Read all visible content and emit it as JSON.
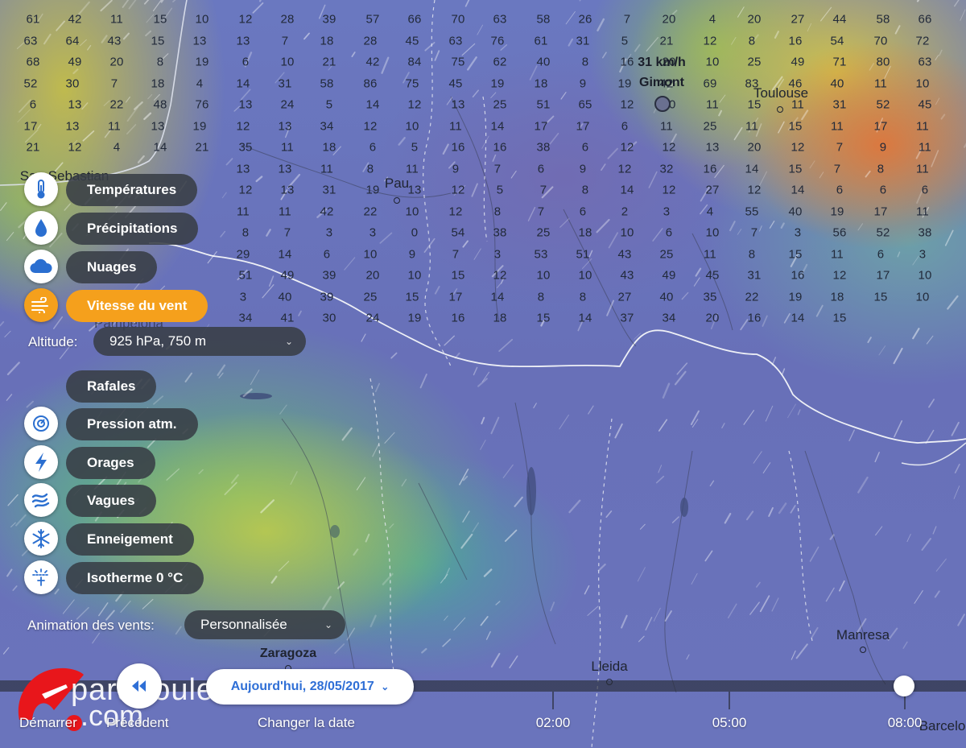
{
  "map": {
    "cities": [
      {
        "name": "Pau"
      },
      {
        "name": "Toulouse"
      },
      {
        "name": "Zaragoza"
      },
      {
        "name": "Lleida"
      },
      {
        "name": "Manresa"
      },
      {
        "name": "Pampelona"
      },
      {
        "name": "San Sebastian"
      },
      {
        "name": "Barcelona"
      }
    ],
    "marker": {
      "speed": "31 km/h",
      "place": "Gimont"
    },
    "wind_values": [
      "61",
      "42",
      "11",
      "15",
      "10",
      "12",
      "28",
      "39",
      "57",
      "66",
      "70",
      "63",
      "58",
      "26",
      "7",
      "20",
      "4",
      "20",
      "27",
      "44",
      "58",
      "66",
      "63",
      "64",
      "43",
      "15",
      "13",
      "13",
      "7",
      "18",
      "28",
      "45",
      "63",
      "76",
      "61",
      "31",
      "5",
      "21",
      "12",
      "8",
      "16",
      "54",
      "70",
      "72",
      "68",
      "49",
      "20",
      "8",
      "19",
      "6",
      "10",
      "21",
      "42",
      "84",
      "75",
      "62",
      "40",
      "8",
      "16",
      "20",
      "10",
      "25",
      "49",
      "71",
      "80",
      "63",
      "52",
      "30",
      "7",
      "18",
      "4",
      "14",
      "31",
      "58",
      "86",
      "75",
      "45",
      "19",
      "18",
      "9",
      "19",
      "42",
      "69",
      "83",
      "46",
      "40",
      "11",
      "10",
      "6",
      "13",
      "22",
      "48",
      "76",
      "13",
      "24",
      "5",
      "14",
      "12",
      "13",
      "25",
      "51",
      "65",
      "12",
      "10",
      "11",
      "15",
      "11",
      "31",
      "52",
      "45",
      "17",
      "13",
      "11",
      "13",
      "19",
      "12",
      "13",
      "34",
      "12",
      "10",
      "11",
      "14",
      "17",
      "17",
      "6",
      "11",
      "25",
      "11",
      "15",
      "11",
      "17",
      "11",
      "21",
      "12",
      "4",
      "14",
      "21",
      "35",
      "11",
      "18",
      "6",
      "5",
      "16",
      "16",
      "38",
      "6",
      "12",
      "12",
      "13",
      "20",
      "12",
      "7",
      "9",
      "11",
      "13",
      "13",
      "11",
      "8",
      "11",
      "9",
      "7",
      "6",
      "9",
      "12",
      "32",
      "16",
      "14",
      "15",
      "7",
      "8",
      "11",
      "12",
      "13",
      "31",
      "19",
      "13",
      "12",
      "5",
      "7",
      "8",
      "14",
      "12",
      "27",
      "12",
      "14",
      "6",
      "6",
      "6",
      "11",
      "11",
      "42",
      "22",
      "10",
      "12",
      "8",
      "7",
      "6",
      "2",
      "3",
      "4",
      "55",
      "40",
      "19",
      "17",
      "11",
      "8",
      "7",
      "3",
      "3",
      "0",
      "54",
      "38",
      "25",
      "18",
      "10",
      "6",
      "10",
      "7",
      "3",
      "56",
      "52",
      "38",
      "29",
      "14",
      "6",
      "10",
      "9",
      "7",
      "3",
      "53",
      "51",
      "43",
      "25",
      "11",
      "8",
      "15",
      "11",
      "6",
      "3",
      "51",
      "49",
      "39",
      "20",
      "10",
      "15",
      "12",
      "10",
      "10",
      "43",
      "49",
      "45",
      "31",
      "16",
      "12",
      "17",
      "10",
      "3",
      "40",
      "39",
      "25",
      "15",
      "17",
      "14",
      "8",
      "8",
      "27",
      "40",
      "35",
      "22",
      "19",
      "18",
      "15",
      "10",
      "34",
      "41",
      "30",
      "24",
      "19",
      "16",
      "18",
      "15",
      "14",
      "37",
      "34",
      "20",
      "16",
      "14",
      "15"
    ]
  },
  "layers": [
    {
      "id": "temperatures",
      "label": "Températures",
      "icon": "thermometer-icon",
      "active": false
    },
    {
      "id": "precipitations",
      "label": "Précipitations",
      "icon": "raindrop-icon",
      "active": false
    },
    {
      "id": "nuages",
      "label": "Nuages",
      "icon": "cloud-icon",
      "active": false
    },
    {
      "id": "vent",
      "label": "Vitesse du vent",
      "icon": "wind-icon",
      "active": true
    },
    {
      "id": "rafales",
      "label": "Rafales",
      "icon": "gust-icon",
      "active": false
    },
    {
      "id": "pression",
      "label": "Pression atm.",
      "icon": "pressure-icon",
      "active": false
    },
    {
      "id": "orages",
      "label": "Orages",
      "icon": "lightning-icon",
      "active": false
    },
    {
      "id": "vagues",
      "label": "Vagues",
      "icon": "wave-icon",
      "active": false
    },
    {
      "id": "enneigement",
      "label": "Enneigement",
      "icon": "snowflake-icon",
      "active": false
    },
    {
      "id": "isotherme",
      "label": "Isotherme 0 °C",
      "icon": "isotherm-icon",
      "active": false
    }
  ],
  "altitude": {
    "label": "Altitude:",
    "value": "925 hPa, 750 m"
  },
  "animation": {
    "label": "Animation des vents:",
    "value": "Personnalisée"
  },
  "bottom": {
    "date_button": "Aujourd'hui, 28/05/2017",
    "start_label": "Démarrer",
    "prev_label": "Précédent",
    "change_date_label": "Changer la date",
    "times": [
      "02:00",
      "05:00",
      "08:00"
    ],
    "logo_line1": "paraboule",
    "logo_line2": ".com"
  },
  "colors": {
    "accent": "#f5a01c",
    "pill": "#383e46",
    "date_text": "#2f6fd6",
    "logo_red": "#e8161b"
  }
}
